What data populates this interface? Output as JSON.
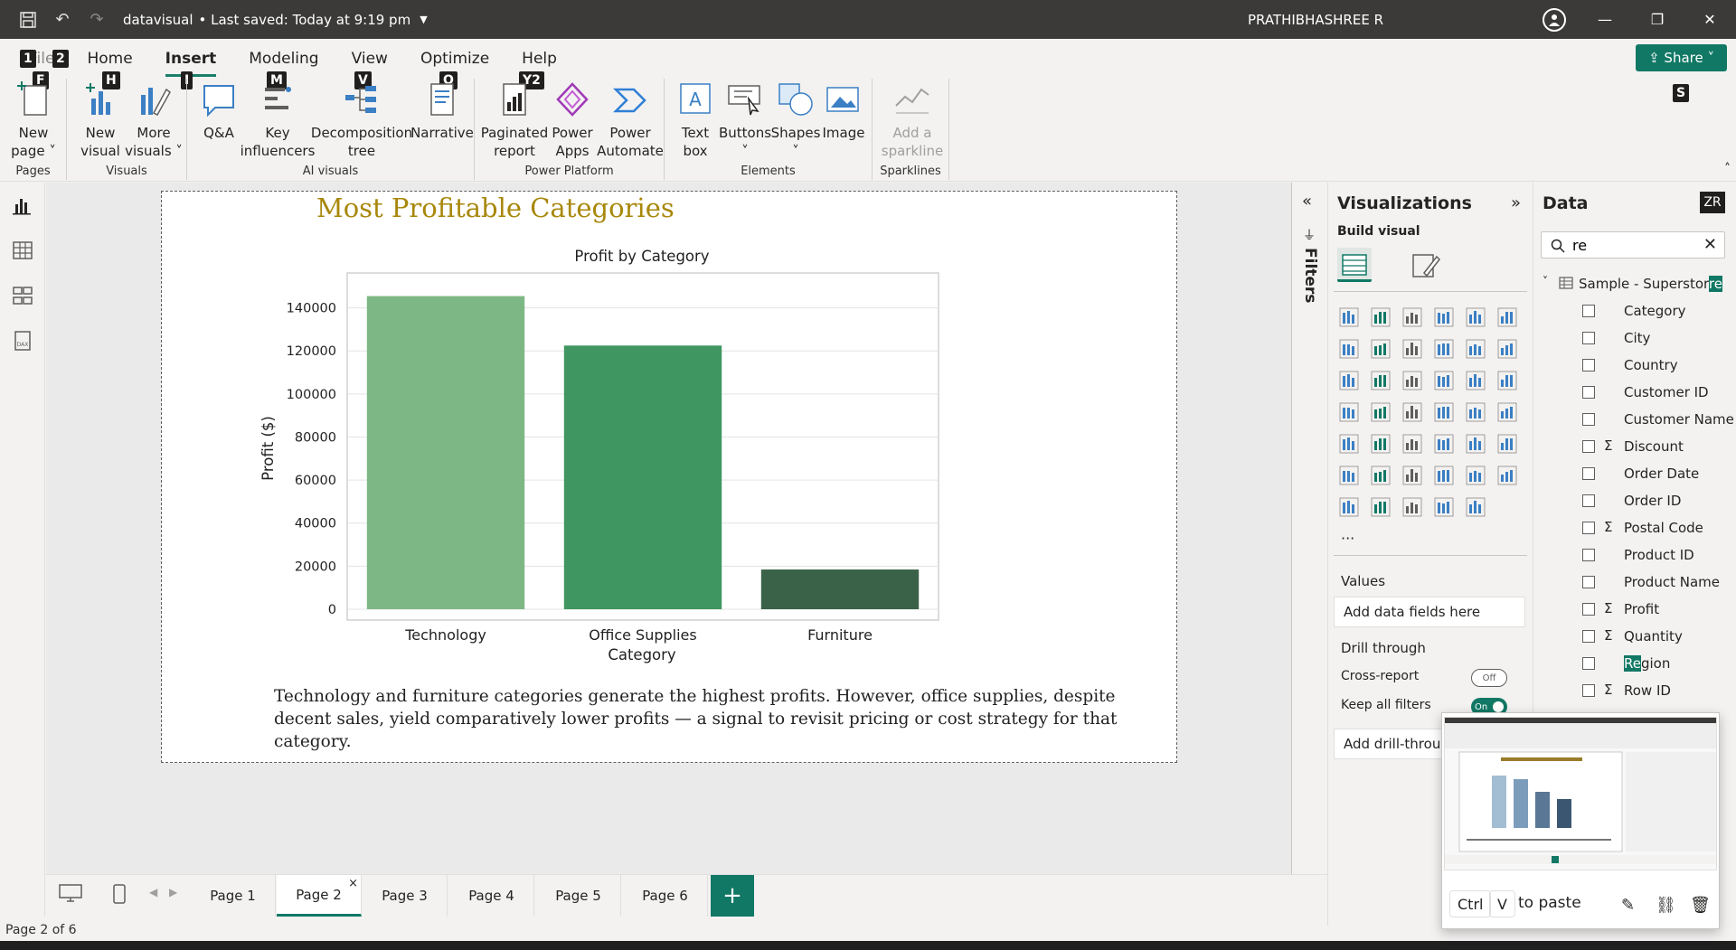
{
  "titlebar": {
    "filename": "datavisual",
    "saved": "• Last saved: Today at 9:19 pm",
    "user": "PRATHIBHASHREE R"
  },
  "ribbon": {
    "tabs": [
      {
        "label": "File",
        "keytip": "F"
      },
      {
        "label": "Home",
        "keytip": "H"
      },
      {
        "label": "Insert",
        "keytip": "I"
      },
      {
        "label": "Modeling",
        "keytip": "M"
      },
      {
        "label": "View",
        "keytip": "V"
      },
      {
        "label": "Optimize",
        "keytip": "O"
      },
      {
        "label": "Help",
        "keytip": "Y2"
      }
    ],
    "extra_keytips": [
      "1",
      "2",
      "S"
    ],
    "share": "Share",
    "groups": {
      "pages": {
        "label": "Pages",
        "new_page_1": "New",
        "new_page_2": "page ˅"
      },
      "visuals": {
        "label": "Visuals",
        "new_visual_1": "New",
        "new_visual_2": "visual",
        "more_visuals_1": "More",
        "more_visuals_2": "visuals ˅"
      },
      "ai": {
        "label": "AI visuals",
        "qa": "Q&A",
        "key_1": "Key",
        "key_2": "influencers",
        "decomp_1": "Decomposition",
        "decomp_2": "tree",
        "narrative": "Narrative"
      },
      "power": {
        "label": "Power Platform",
        "paginated_1": "Paginated",
        "paginated_2": "report",
        "apps_1": "Power",
        "apps_2": "Apps",
        "automate_1": "Power",
        "automate_2": "Automate"
      },
      "elements": {
        "label": "Elements",
        "textbox_1": "Text",
        "textbox_2": "box",
        "buttons": "Buttons",
        "shapes": "Shapes",
        "image": "Image"
      },
      "sparklines": {
        "label": "Sparklines",
        "add_1": "Add a",
        "add_2": "sparkline"
      }
    }
  },
  "report": {
    "title": "Most Profitable Categories",
    "narrative": "Technology and furniture categories generate the highest profits. However, office supplies, despite decent sales, yield comparatively lower profits — a signal to revisit pricing or cost strategy for that category."
  },
  "chart_data": {
    "type": "bar",
    "title": "Profit by Category",
    "xlabel": "Category",
    "ylabel": "Profit ($)",
    "categories": [
      "Technology",
      "Office Supplies",
      "Furniture"
    ],
    "values": [
      145454,
      122490,
      18451
    ],
    "ylim": [
      0,
      152000
    ],
    "yticks": [
      0,
      20000,
      40000,
      60000,
      80000,
      100000,
      120000,
      140000
    ],
    "colors": [
      "#7db785",
      "#3f9660",
      "#3a6248"
    ],
    "grid": true
  },
  "pages": {
    "tabs": [
      "Page 1",
      "Page 2",
      "Page 3",
      "Page 4",
      "Page 5",
      "Page 6"
    ],
    "active": "Page 2",
    "add": "+"
  },
  "status": {
    "page_indicator": "Page 2 of 6"
  },
  "filters": {
    "label": "Filters"
  },
  "viz_pane": {
    "title": "Visualizations",
    "build_visual": "Build visual",
    "more": "···",
    "values_label": "Values",
    "values_placeholder": "Add data fields here",
    "drill_through": "Drill through",
    "cross_report": "Cross-report",
    "cross_report_state": "Off",
    "keep_filters": "Keep all filters",
    "keep_filters_state": "On",
    "add_drill": "Add drill-through"
  },
  "data_pane": {
    "title": "Data",
    "badge": "ZR",
    "search_value": "re",
    "table_pre": "Sample - Superstor",
    "table_hl": "re",
    "fields": [
      {
        "name": "Category",
        "sigma": false
      },
      {
        "name": "City",
        "sigma": false
      },
      {
        "name": "Country",
        "sigma": false
      },
      {
        "name": "Customer ID",
        "sigma": false
      },
      {
        "name": "Customer Name",
        "sigma": false
      },
      {
        "name": "Discount",
        "sigma": true
      },
      {
        "name": "Order Date",
        "sigma": false
      },
      {
        "name": "Order ID",
        "sigma": false
      },
      {
        "name": "Postal Code",
        "sigma": true
      },
      {
        "name": "Product ID",
        "sigma": false
      },
      {
        "name": "Product Name",
        "sigma": false
      },
      {
        "name": "Profit",
        "sigma": true
      },
      {
        "name": "Quantity",
        "sigma": true
      },
      {
        "name": "Region",
        "sigma": false,
        "hl": "Re",
        "rest": "gion"
      },
      {
        "name": "Row ID",
        "sigma": true
      }
    ]
  },
  "clipboard": {
    "key1": "Ctrl",
    "key2": "V",
    "text": "to paste"
  }
}
